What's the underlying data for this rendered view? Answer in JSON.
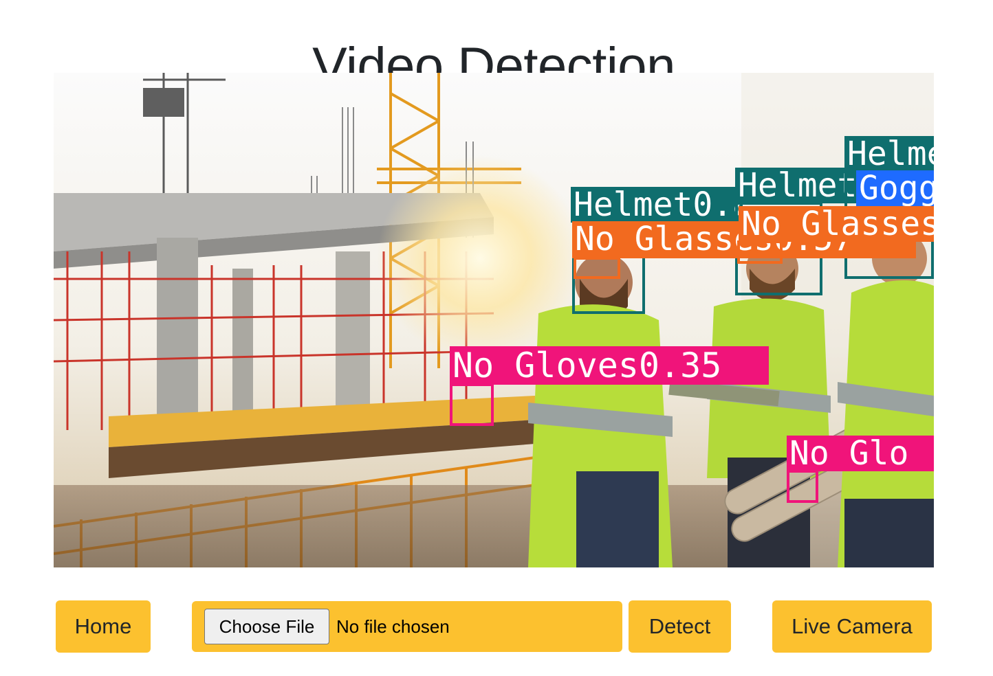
{
  "page": {
    "title": "Video Detection"
  },
  "video": {
    "detections": [
      {
        "label": "Helmet0.87",
        "color": "#0f6e6e"
      },
      {
        "label": "No Glasses0.57",
        "color": "#f26a1f"
      },
      {
        "label": "Helmet",
        "color": "#0f6e6e"
      },
      {
        "label": "No Glasses",
        "color": "#f26a1f"
      },
      {
        "label": "Helmet",
        "color": "#0f6e6e"
      },
      {
        "label": "Goggles",
        "color": "#1e6bff"
      },
      {
        "label": "No Gloves0.35",
        "color": "#f0147a"
      },
      {
        "label": "No Glo",
        "color": "#f0147a"
      }
    ]
  },
  "controls": {
    "home_label": "Home",
    "choose_file_label": "Choose File",
    "file_status": "No file chosen",
    "detect_label": "Detect",
    "live_camera_label": "Live Camera"
  },
  "colors": {
    "button_bg": "#fcc12f",
    "title_text": "#212529"
  }
}
